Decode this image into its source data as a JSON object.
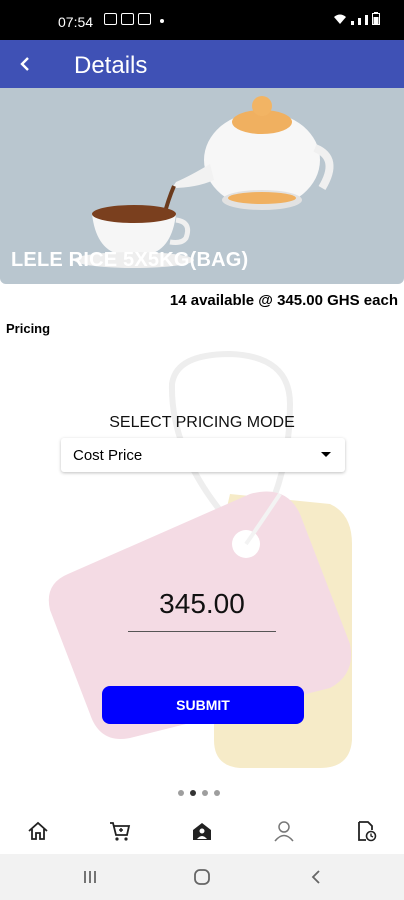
{
  "status_bar": {
    "time": "07:54"
  },
  "app_bar": {
    "title": "Details"
  },
  "product": {
    "name": "LELE RICE 5X5KG(BAG)",
    "availability": "14 available @ 345.00 GHS each"
  },
  "pricing": {
    "section_label": "Pricing",
    "mode_title": "SELECT PRICING MODE",
    "selected_mode": "Cost Price",
    "price_value": "345.00",
    "submit_label": "SUBMIT"
  },
  "pager": {
    "count": 4,
    "active_index": 1
  },
  "bottom_nav": [
    "home-icon",
    "cart-icon",
    "store-icon",
    "person-icon",
    "document-clock-icon"
  ],
  "colors": {
    "app_bar": "#3f51b5",
    "submit": "#0000ff",
    "hero_bg": "#b9c6cf"
  }
}
